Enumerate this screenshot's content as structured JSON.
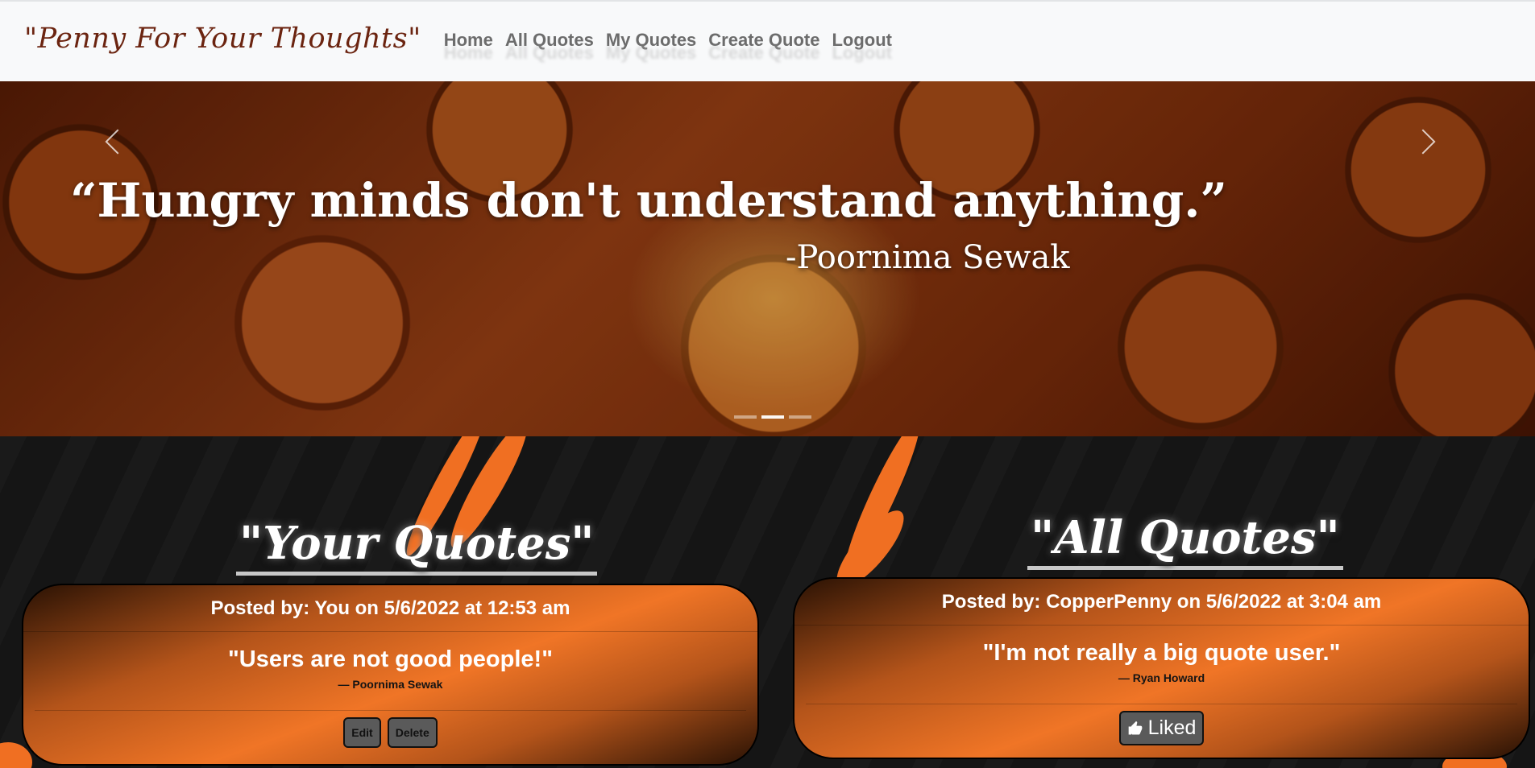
{
  "navbar": {
    "brand": "\"Penny For Your Thoughts\"",
    "links": [
      "Home",
      "All Quotes",
      "My Quotes",
      "Create Quote",
      "Logout"
    ]
  },
  "carousel": {
    "quote": "“Hungry minds don't understand anything.”",
    "author": "-Poornima Sewak",
    "slide_count": 3,
    "active_slide": 2
  },
  "your_quotes": {
    "title": "\"Your Quotes\"",
    "card": {
      "posted": "Posted by: You on 5/6/2022 at 12:53 am",
      "quote": "\"Users are not good people!\"",
      "author": "— Poornima Sewak",
      "edit_label": "Edit",
      "delete_label": "Delete"
    }
  },
  "all_quotes": {
    "title": "\"All Quotes\"",
    "card": {
      "posted": "Posted by: CopperPenny on 5/6/2022 at 3:04 am",
      "quote": "\"I'm not really a big quote user.\"",
      "author": "— Ryan Howard",
      "liked_label": "Liked"
    }
  },
  "colors": {
    "accent": "#f06f22",
    "brand": "#6b2410",
    "nav_bg": "#f8f9fa",
    "page_bg": "#151515"
  }
}
